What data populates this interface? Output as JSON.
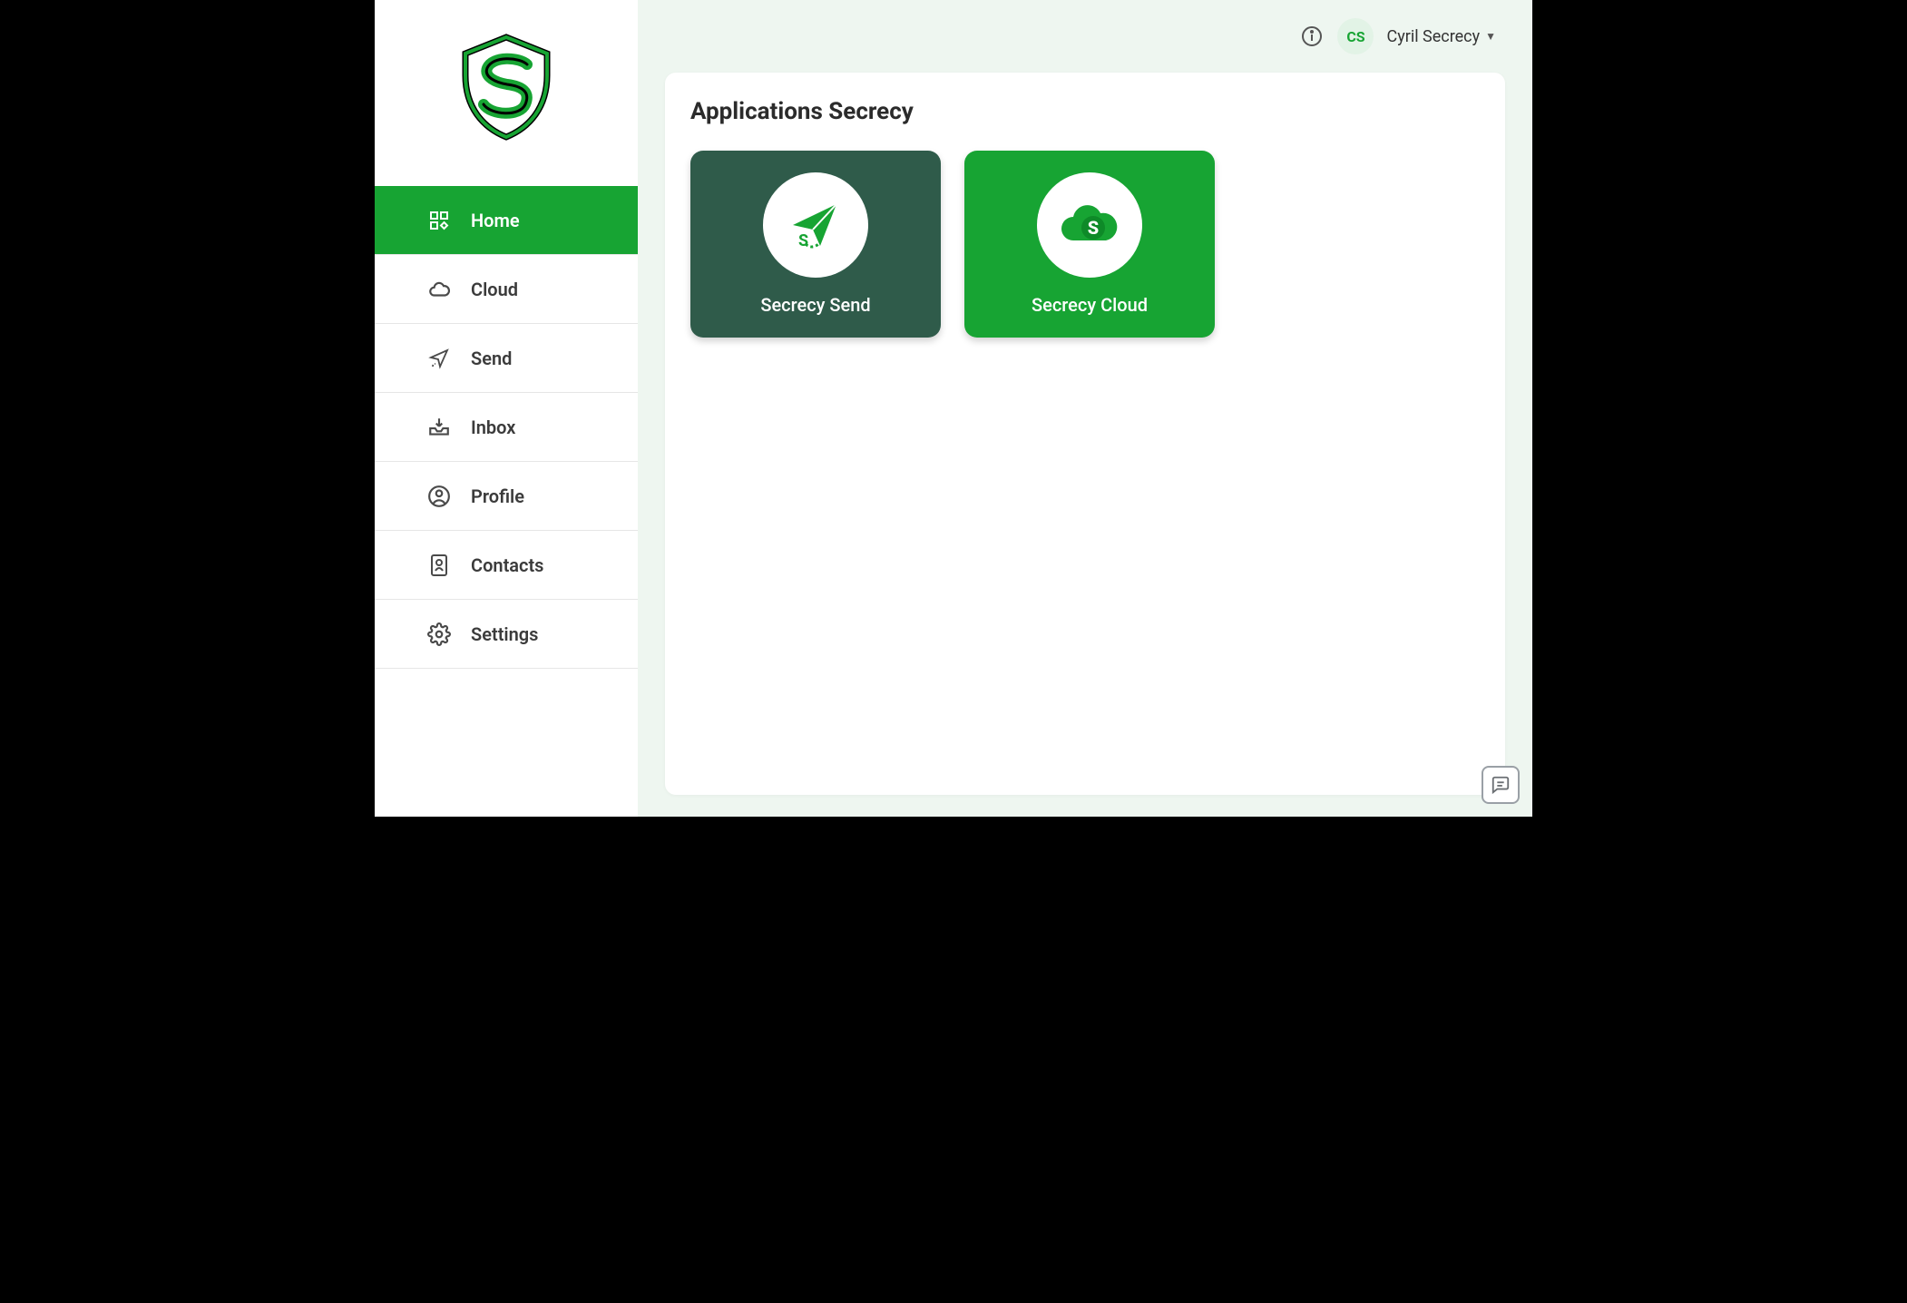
{
  "sidebar": {
    "items": [
      {
        "label": "Home",
        "icon": "grid-icon",
        "active": true
      },
      {
        "label": "Cloud",
        "icon": "cloud-icon",
        "active": false
      },
      {
        "label": "Send",
        "icon": "plane-icon",
        "active": false
      },
      {
        "label": "Inbox",
        "icon": "inbox-icon",
        "active": false
      },
      {
        "label": "Profile",
        "icon": "user-icon",
        "active": false
      },
      {
        "label": "Contacts",
        "icon": "id-card-icon",
        "active": false
      },
      {
        "label": "Settings",
        "icon": "gear-icon",
        "active": false
      }
    ]
  },
  "header": {
    "avatar_initials": "CS",
    "user_name": "Cyril Secrecy"
  },
  "main": {
    "panel_title": "Applications Secrecy",
    "tiles": [
      {
        "label": "Secrecy Send",
        "variant": "dark",
        "icon": "send-app-icon"
      },
      {
        "label": "Secrecy Cloud",
        "variant": "green",
        "icon": "cloud-app-icon"
      }
    ]
  }
}
